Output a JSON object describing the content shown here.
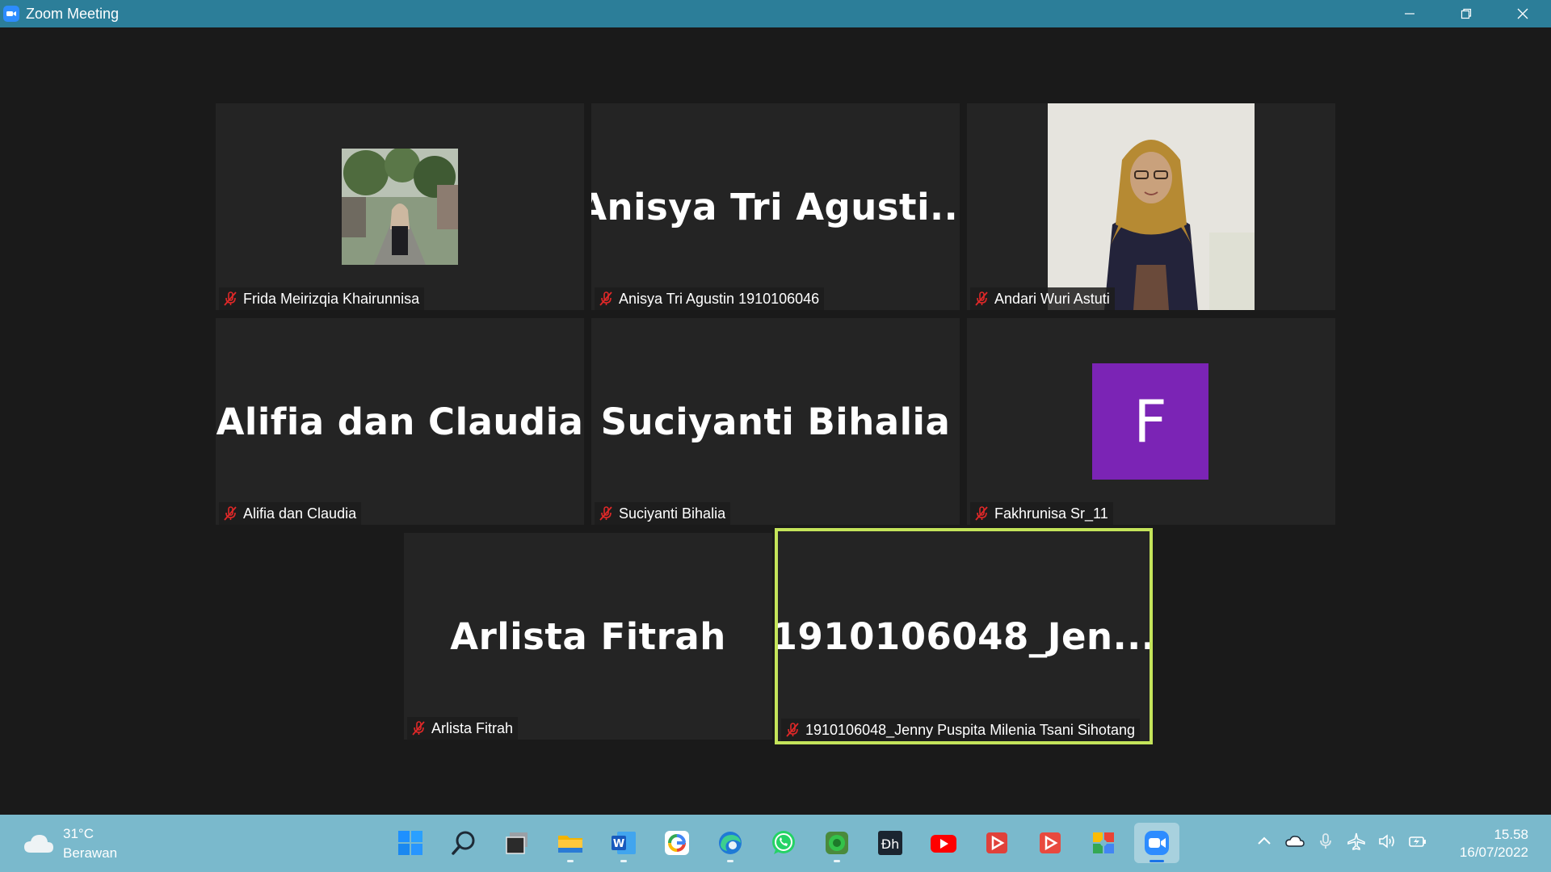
{
  "window": {
    "title": "Zoom Meeting"
  },
  "tiles": [
    {
      "big_name": "",
      "label": "Frida Meirizqia Khairunnisa",
      "kind": "photo"
    },
    {
      "big_name": "Anisya Tri Agusti...",
      "label": "Anisya Tri Agustin 1910106046",
      "kind": "name"
    },
    {
      "big_name": "",
      "label": "Andari Wuri Astuti",
      "kind": "photo"
    },
    {
      "big_name": "Alifia dan Claudia",
      "label": "Alifia dan Claudia",
      "kind": "name"
    },
    {
      "big_name": "Suciyanti Bihalia",
      "label": "Suciyanti Bihalia",
      "kind": "name"
    },
    {
      "big_name": "",
      "label": "Fakhrunisa Sr_11",
      "kind": "avatar",
      "avatar_letter": "F"
    },
    {
      "big_name": "Arlista Fitrah",
      "label": "Arlista Fitrah",
      "kind": "name"
    },
    {
      "big_name": "1910106048_Jen...",
      "label": "1910106048_Jenny Puspita Milenia Tsani Sihotang",
      "kind": "name",
      "active_speaker": true
    }
  ],
  "taskbar": {
    "weather": {
      "temp": "31°C",
      "condition": "Berawan"
    },
    "apps": [
      "windows-start-icon",
      "search-icon",
      "task-view-icon",
      "file-explorer-icon",
      "word-icon",
      "google-icon",
      "edge-icon",
      "whatsapp-icon",
      "chrome-green-icon",
      "dh-app-icon",
      "youtube-icon",
      "video-app-icon",
      "video-app-2-icon",
      "puzzle-app-icon",
      "zoom-icon"
    ],
    "clock": {
      "time": "15.58",
      "date": "16/07/2022"
    }
  },
  "colors": {
    "titlebar": "#2c7e99",
    "tile_bg": "#242424",
    "active_border": "#c4e45a",
    "mute_red": "#e02828",
    "avatar_purple": "#7b24b5",
    "taskbar": "#7ab9cc"
  }
}
